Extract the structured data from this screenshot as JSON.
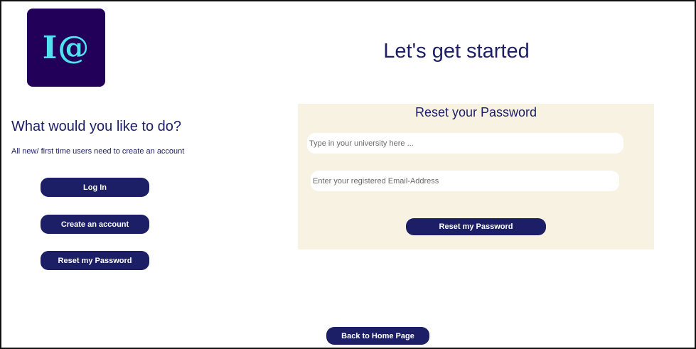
{
  "logo": {
    "text": "I@"
  },
  "page": {
    "title": "Let's get started"
  },
  "left": {
    "heading": "What would you like to do?",
    "note": "All new/ first time users need to create an account",
    "buttons": {
      "login": "Log In",
      "create": "Create an account",
      "reset": "Reset my Password"
    }
  },
  "panel": {
    "title": "Reset your Password",
    "university": {
      "placeholder": "Type in your university here ..."
    },
    "email": {
      "placeholder": "Enter your registered Email-Address"
    },
    "submit": "Reset my Password"
  },
  "footer": {
    "home_button": "Back to Home Page"
  },
  "colors": {
    "primary": "#1c1e66",
    "logo_bg": "#22005a",
    "logo_text": "#4fe3f0",
    "panel_bg": "#f7f2e2"
  }
}
